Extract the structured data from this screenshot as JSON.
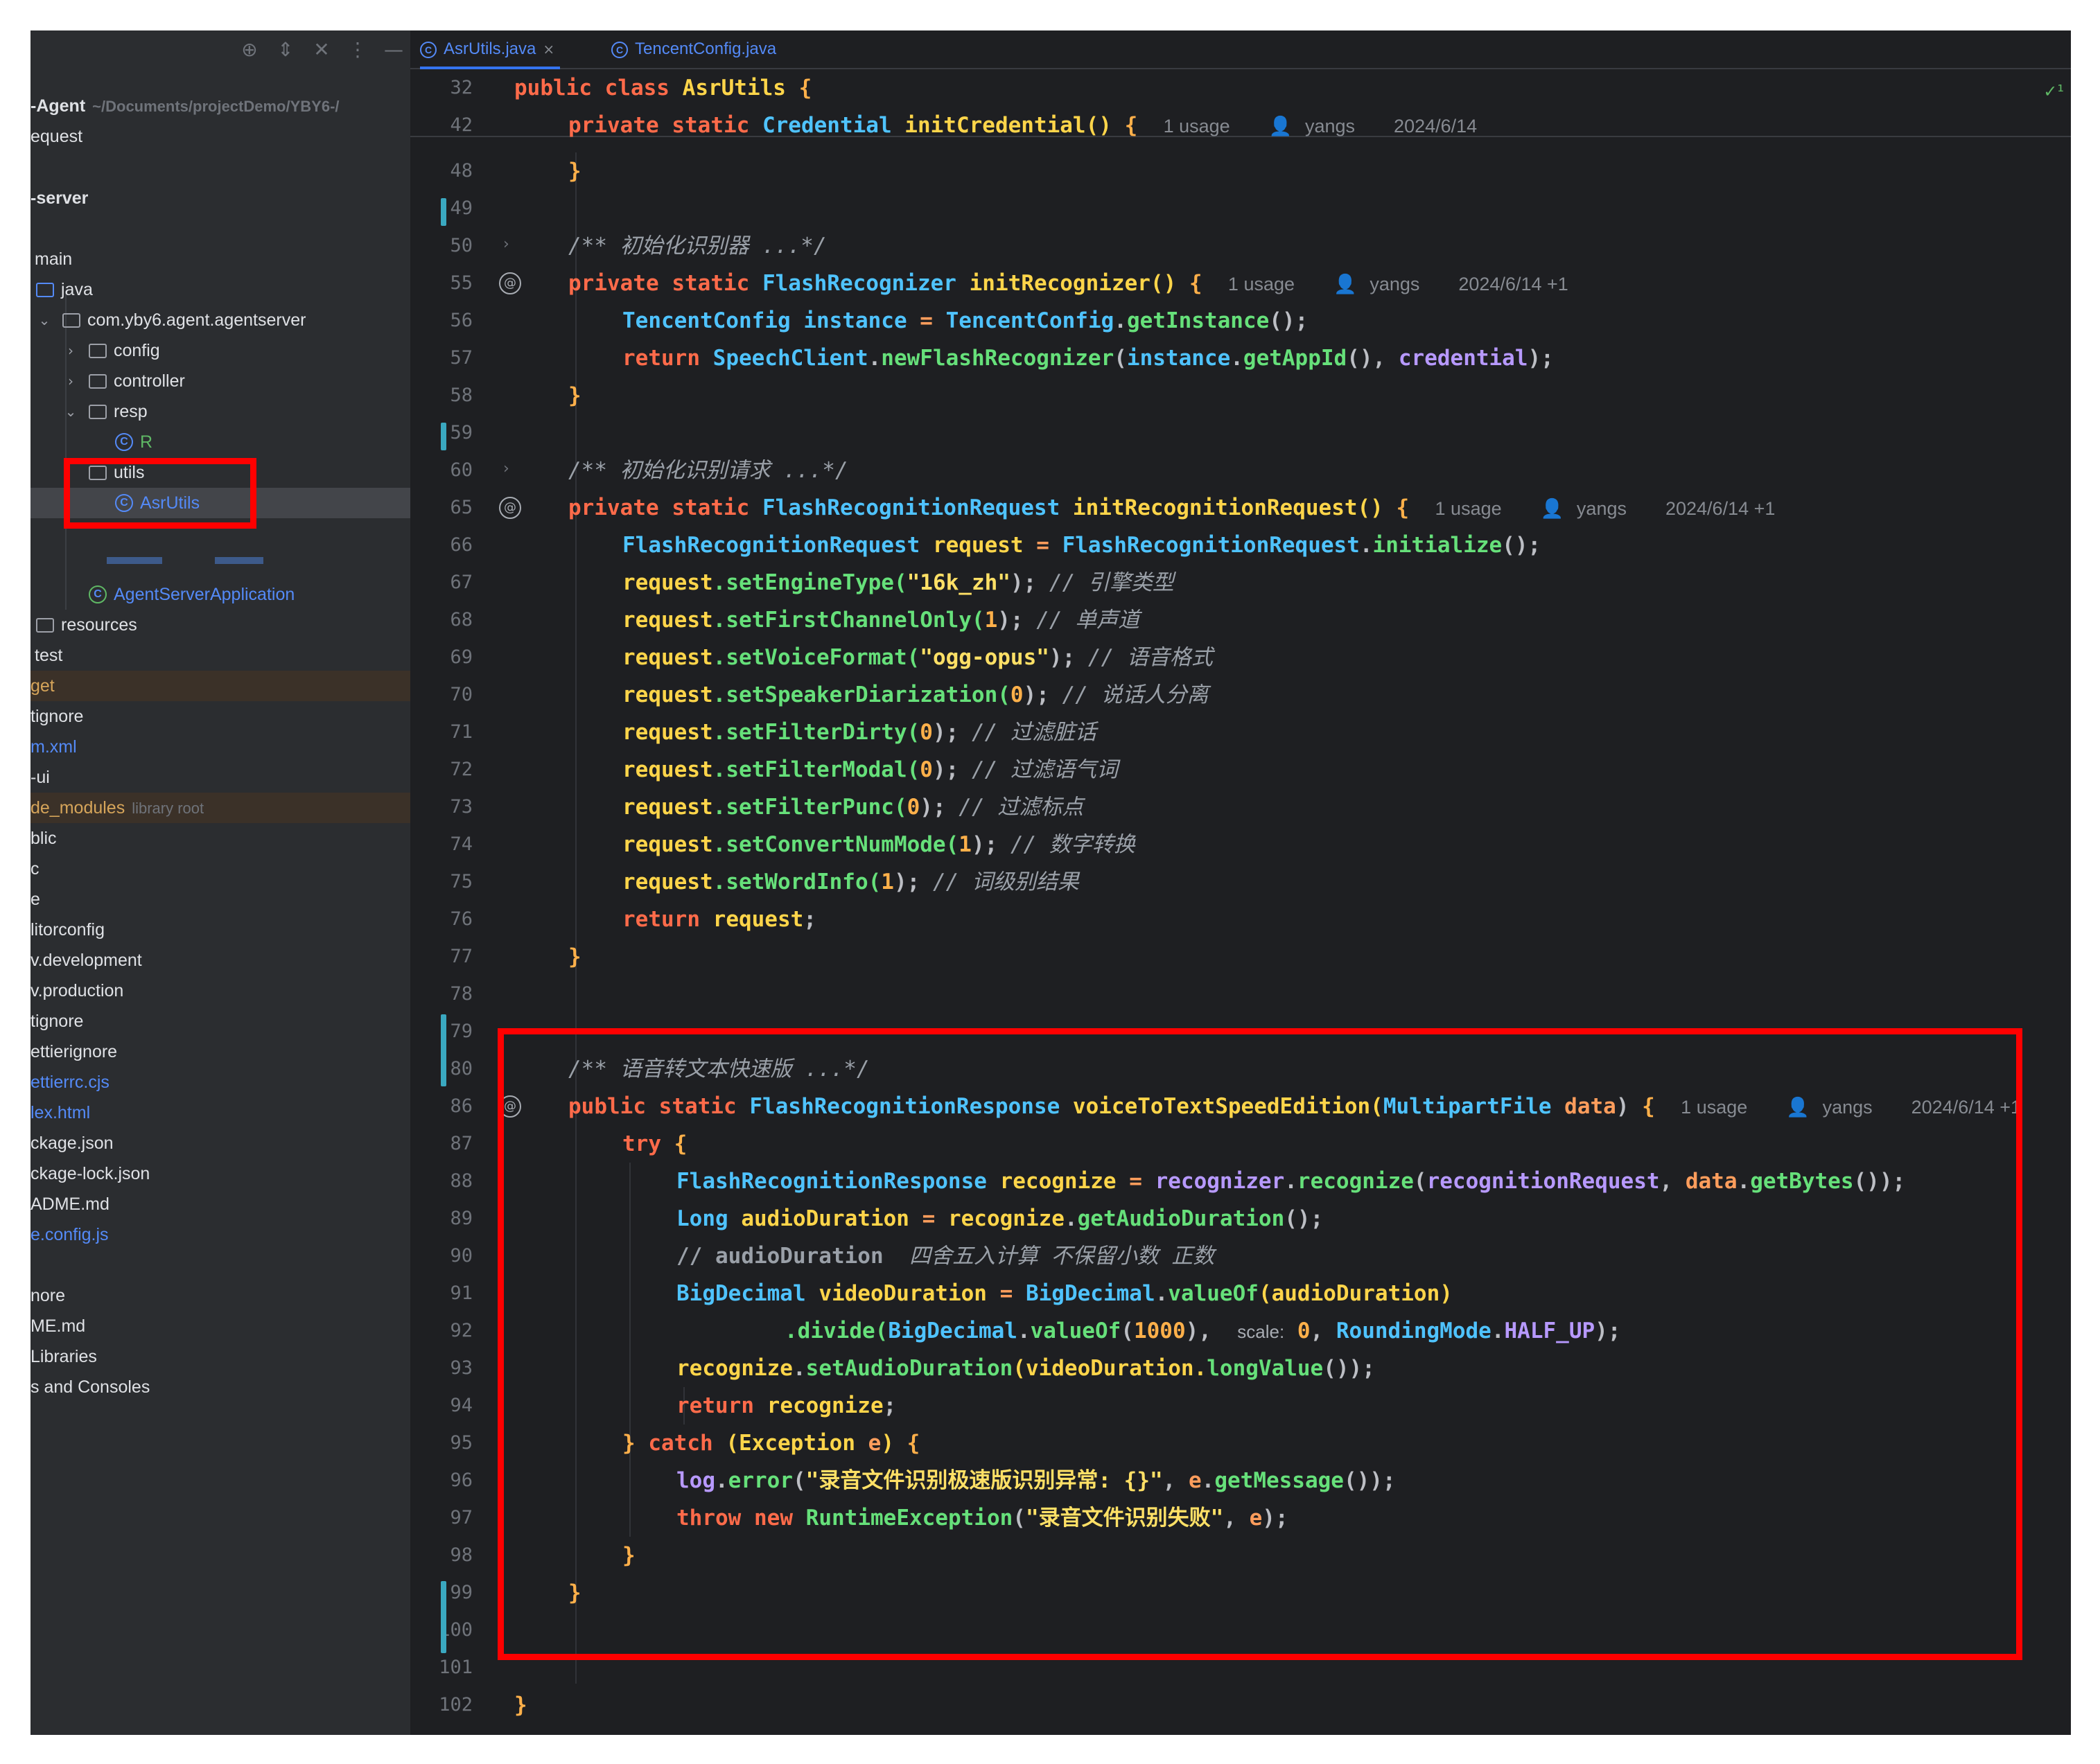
{
  "sidebar": {
    "rows": [
      {
        "label": "-Agent",
        "suffix": "~/Documents/projectDemo/YBY6-/"
      },
      {
        "label": "equest"
      },
      {
        "label": "-server"
      },
      {
        "label": "main"
      },
      {
        "label": "java"
      },
      {
        "label": "com.yby6.agent.agentserver"
      },
      {
        "label": "config"
      },
      {
        "label": "controller"
      },
      {
        "label": "resp"
      },
      {
        "label": "R"
      },
      {
        "label": "utils"
      },
      {
        "label": "AsrUtils"
      },
      {
        "label": "AgentServerApplication"
      },
      {
        "label": "resources"
      },
      {
        "label": "test"
      },
      {
        "label": "get"
      },
      {
        "label": "tignore"
      },
      {
        "label": "m.xml"
      },
      {
        "label": "-ui"
      },
      {
        "label": "de_modules",
        "suffix": "library root"
      },
      {
        "label": "blic"
      },
      {
        "label": "c"
      },
      {
        "label": "e"
      },
      {
        "label": "litorconfig"
      },
      {
        "label": "v.development"
      },
      {
        "label": "v.production"
      },
      {
        "label": "tignore"
      },
      {
        "label": "ettierignore"
      },
      {
        "label": "ettierrc.cjs"
      },
      {
        "label": "lex.html"
      },
      {
        "label": "ckage.json"
      },
      {
        "label": "ckage-lock.json"
      },
      {
        "label": "ADME.md"
      },
      {
        "label": "e.config.js"
      },
      {
        "label": "nore"
      },
      {
        "label": "ME.md"
      },
      {
        "label": "Libraries"
      },
      {
        "label": "s and Consoles"
      }
    ]
  },
  "tabs": [
    {
      "label": "AsrUtils.java",
      "close": "×"
    },
    {
      "label": "TencentConfig.java"
    }
  ],
  "tab_icon_glyph": "C",
  "status_check": "✓¹",
  "gutter": {
    "lines": [
      "32",
      "42",
      "48",
      "49",
      "50",
      "55",
      "56",
      "57",
      "58",
      "59",
      "60",
      "65",
      "66",
      "67",
      "68",
      "69",
      "70",
      "71",
      "72",
      "73",
      "74",
      "75",
      "76",
      "77",
      "78",
      "79",
      "80",
      "86",
      "87",
      "88",
      "89",
      "90",
      "91",
      "92",
      "93",
      "94",
      "95",
      "96",
      "97",
      "98",
      "99",
      "100",
      "101",
      "102"
    ]
  },
  "hints": {
    "usage": "1 usage",
    "author": "yangs",
    "date1": "2024/6/14",
    "date2": "2024/6/14 +1",
    "scale": "scale:"
  },
  "code": {
    "l32": [
      "public",
      "class",
      "AsrUtils",
      "{"
    ],
    "l42": [
      "private",
      "static",
      "Credential",
      "initCredential()",
      "{"
    ],
    "l48": "}",
    "l50": "/** 初始化识别器 ...*/",
    "l55": [
      "private",
      "static",
      "FlashRecognizer",
      "initRecognizer()",
      "{"
    ],
    "l56": [
      "TencentConfig",
      "instance",
      "=",
      "TencentConfig",
      ".",
      "getInstance",
      "();"
    ],
    "l57": [
      "return",
      "SpeechClient",
      ".",
      "newFlashRecognizer",
      "(",
      "instance",
      ".",
      "getAppId",
      "(), ",
      "credential",
      ");"
    ],
    "l58": "}",
    "l60": "/** 初始化识别请求 ...*/",
    "l65": [
      "private",
      "static",
      "FlashRecognitionRequest",
      "initRecognitionRequest()",
      "{"
    ],
    "l66": [
      "FlashRecognitionRequest",
      "request",
      "=",
      "FlashRecognitionRequest",
      ".",
      "initialize",
      "();"
    ],
    "l67": [
      "request",
      ".setEngineType(",
      "\"16k_zh\"",
      "); ",
      "// 引擎类型"
    ],
    "l68": [
      "request",
      ".setFirstChannelOnly(",
      "1",
      "); ",
      "// 单声道"
    ],
    "l69": [
      "request",
      ".setVoiceFormat(",
      "\"ogg-opus\"",
      "); ",
      "// 语音格式"
    ],
    "l70": [
      "request",
      ".setSpeakerDiarization(",
      "0",
      "); ",
      "// 说话人分离"
    ],
    "l71": [
      "request",
      ".setFilterDirty(",
      "0",
      "); ",
      "// 过滤脏话"
    ],
    "l72": [
      "request",
      ".setFilterModal(",
      "0",
      "); ",
      "// 过滤语气词"
    ],
    "l73": [
      "request",
      ".setFilterPunc(",
      "0",
      "); ",
      "// 过滤标点"
    ],
    "l74": [
      "request",
      ".setConvertNumMode(",
      "1",
      "); ",
      "// 数字转换"
    ],
    "l75": [
      "request",
      ".setWordInfo(",
      "1",
      "); ",
      "// 词级别结果"
    ],
    "l76": [
      "return",
      "request",
      ";"
    ],
    "l77": "}",
    "l80": "/** 语音转文本快速版 ...*/",
    "l86": [
      "public",
      "static",
      "FlashRecognitionResponse",
      "voiceToTextSpeedEdition(",
      "MultipartFile",
      "data",
      ")",
      "{"
    ],
    "l87": [
      "try",
      "{"
    ],
    "l88": [
      "FlashRecognitionResponse",
      "recognize",
      "=",
      "recognizer",
      ".",
      "recognize",
      "(",
      "recognitionRequest",
      ", ",
      "data",
      ".",
      "getBytes",
      "());"
    ],
    "l89": [
      "Long",
      "audioDuration",
      "=",
      "recognize",
      ".",
      "getAudioDuration",
      "();"
    ],
    "l90": [
      "// audioDuration",
      "四舍五入计算 不保留小数 正数"
    ],
    "l91": [
      "BigDecimal",
      "videoDuration",
      "=",
      "BigDecimal",
      ".",
      "valueOf",
      "(audioDuration)"
    ],
    "l92": [
      ".divide(",
      "BigDecimal",
      ".",
      "valueOf",
      "(",
      "1000",
      "), ",
      "0",
      ", ",
      "RoundingMode",
      ".",
      "HALF_UP",
      ");"
    ],
    "l93": [
      "recognize",
      ".",
      "setAudioDuration",
      "(videoDuration.",
      "longValue",
      "());"
    ],
    "l94": [
      "return",
      "recognize",
      ";"
    ],
    "l95": [
      "}",
      "catch",
      "(Exception",
      "e",
      ")",
      "{"
    ],
    "l96": [
      "log",
      ".",
      "error",
      "(",
      "\"录音文件识别极速版识别异常: {}\"",
      ", ",
      "e",
      ".",
      "getMessage",
      "());"
    ],
    "l97": [
      "throw",
      "new",
      "RuntimeException",
      "(",
      "\"录音文件识别失败\"",
      ", ",
      "e",
      ");"
    ],
    "l98": "}",
    "l99": "}",
    "l102": "}"
  },
  "colors": {
    "accent_box": "#ff0000",
    "background": "#1e1f22",
    "sidebar": "#2b2d30",
    "keyword": "#ff6b4a",
    "type": "#4fc3ff",
    "method": "#66e07a",
    "string": "#ffe066"
  },
  "icons": {
    "toolbar": [
      "target-icon",
      "expand-collapse-icon",
      "close-icon",
      "more-icon",
      "minimize-icon"
    ],
    "toolbar_glyphs": [
      "⊕",
      "⇕",
      "✕",
      "⋮",
      "—"
    ]
  }
}
